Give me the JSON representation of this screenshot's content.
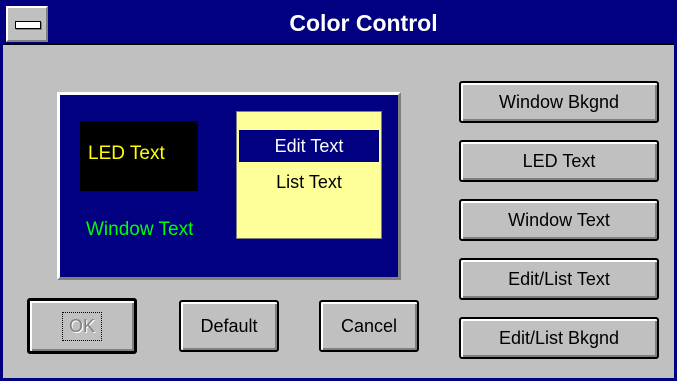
{
  "window": {
    "title": "Color Control",
    "colors": {
      "titlebar": "#000080",
      "face": "#c0c0c0",
      "preview_background": "#000080",
      "led_background": "#000000",
      "led_text": "#ffff00",
      "window_text": "#00ff00",
      "editlist_background": "#ffff99",
      "edit_selection": "#000080"
    }
  },
  "preview": {
    "led_text": "LED Text",
    "window_text": "Window Text",
    "edit_text": "Edit Text",
    "list_text": "List Text"
  },
  "color_buttons": {
    "window_bkgnd": "Window Bkgnd",
    "led_text": "LED Text",
    "window_text": "Window Text",
    "editlist_text": "Edit/List Text",
    "editlist_bkgnd": "Edit/List Bkgnd"
  },
  "actions": {
    "ok": "OK",
    "default": "Default",
    "cancel": "Cancel"
  },
  "icons": {
    "system_menu": "system-menu-icon"
  }
}
